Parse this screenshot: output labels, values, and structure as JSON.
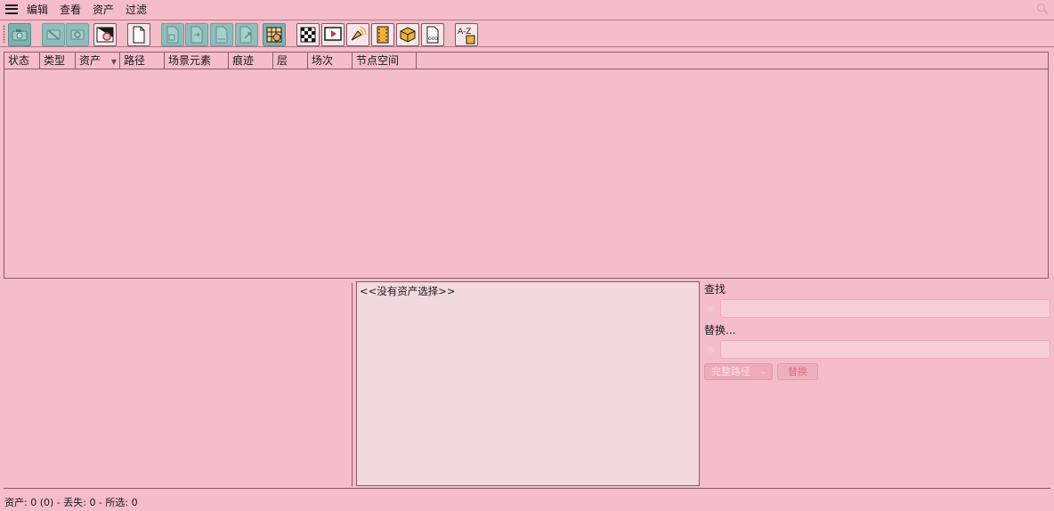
{
  "menu": {
    "items": [
      "编辑",
      "查看",
      "资产",
      "过滤"
    ]
  },
  "toolbar": {
    "buttons": [
      {
        "name": "camera-icon-button",
        "style": "teal",
        "icon": "camera-icon"
      },
      {
        "name": "hide-icon-button",
        "style": "dim",
        "icon": "eye-slash-icon"
      },
      {
        "name": "show-icon-button",
        "style": "dim",
        "icon": "eye-icon"
      },
      {
        "name": "reveal-icon-button",
        "style": "light",
        "icon": "magnify-icon"
      },
      {
        "name": "new-file-button",
        "style": "light",
        "icon": "file-icon"
      },
      {
        "name": "copy-path-button",
        "style": "dim",
        "icon": "file-copy-icon"
      },
      {
        "name": "swap-path-button",
        "style": "dim",
        "icon": "file-swap-icon"
      },
      {
        "name": "relink-button",
        "style": "dim",
        "icon": "file-link-icon"
      },
      {
        "name": "reload-button",
        "style": "dim",
        "icon": "file-reload-icon"
      },
      {
        "name": "grid-button",
        "style": "teal",
        "icon": "grid-icon"
      },
      {
        "name": "filter-texture-button",
        "style": "light",
        "icon": "checker-icon"
      },
      {
        "name": "filter-video-button",
        "style": "light",
        "icon": "play-icon"
      },
      {
        "name": "filter-audio-button",
        "style": "light",
        "icon": "audio-icon"
      },
      {
        "name": "filter-film-button",
        "style": "light",
        "icon": "film-icon"
      },
      {
        "name": "filter-box-button",
        "style": "light",
        "icon": "cube-icon"
      },
      {
        "name": "filter-other-button",
        "style": "light",
        "icon": "dots-file-icon"
      },
      {
        "name": "sort-az-button",
        "style": "light",
        "icon": "az-icon"
      }
    ]
  },
  "table": {
    "columns": [
      "状态",
      "类型",
      "资产",
      "路径",
      "场景元素",
      "痕迹",
      "层",
      "场次",
      "节点空间"
    ]
  },
  "detail": {
    "placeholder": "<<没有资产选择>>"
  },
  "find_replace": {
    "find_label": "查找",
    "replace_label": "替换...",
    "mode_select": "完整路径",
    "replace_button": "替换"
  },
  "status_bar": {
    "text": "资产: 0 (0) - 丢失: 0 - 所选: 0"
  }
}
